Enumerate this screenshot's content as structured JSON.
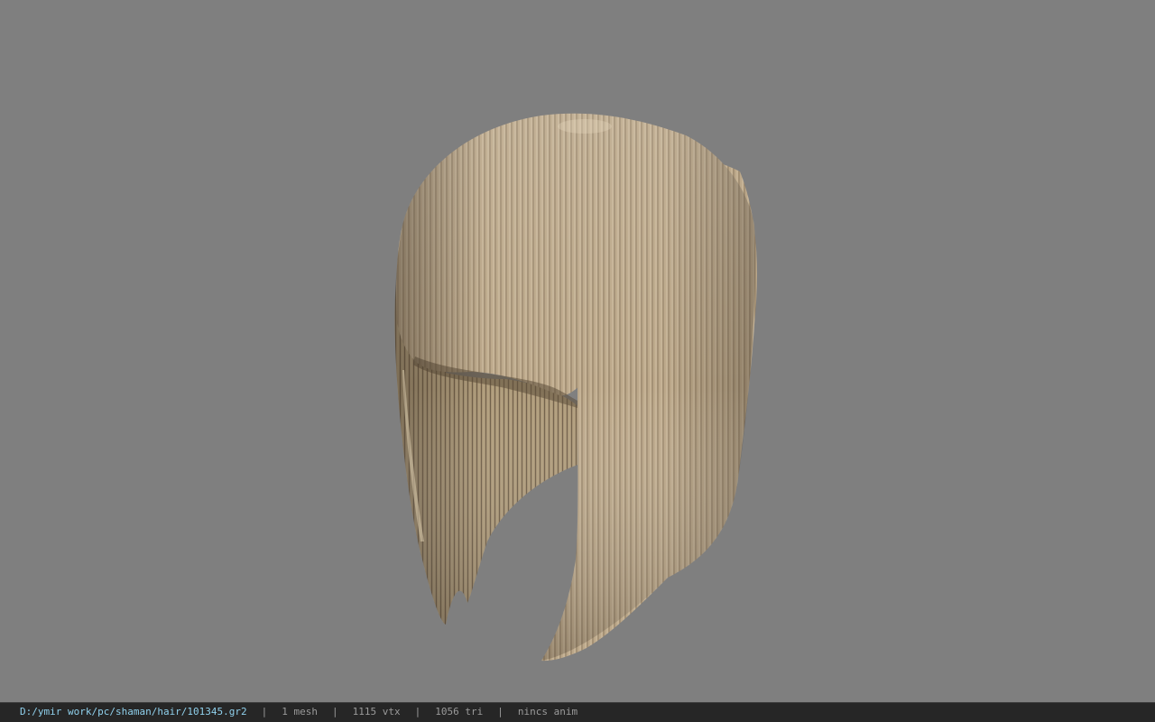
{
  "viewport": {
    "background_color": "#7f7f7f",
    "model": {
      "name": "hair-model",
      "base_color": "#b9a587",
      "highlight_color": "#d8c8ac",
      "shadow_color": "#5b4c39"
    }
  },
  "status_bar": {
    "file_path": "D:/ymir work/pc/shaman/hair/101345.gr2",
    "separator": "|",
    "mesh_count": "1 mesh",
    "vertex_count": "1115 vtx",
    "triangle_count": "1056 tri",
    "animation_status": "nincs anim",
    "path_color": "#8fd0ec",
    "text_color": "#9a9a9a",
    "background_color": "#262626"
  }
}
